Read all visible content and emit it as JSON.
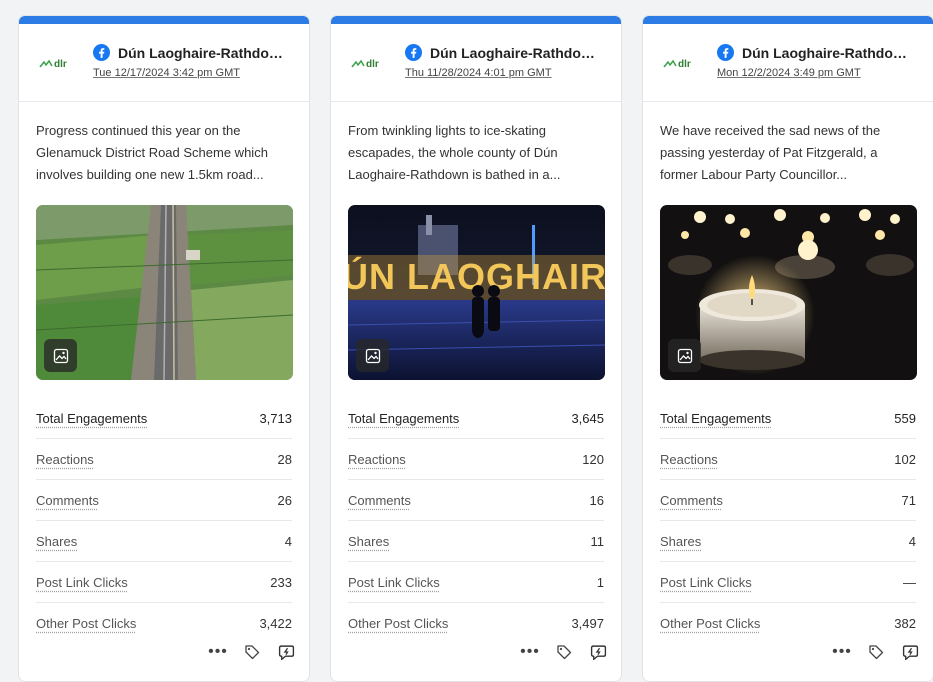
{
  "colors": {
    "accent": "#2d7be5",
    "facebook": "#1877f2",
    "dlr_green": "#3aa04a"
  },
  "icons": {
    "network": "facebook-icon",
    "media": "image-icon",
    "more": "more-icon",
    "tag": "tag-icon",
    "reply": "reply-icon"
  },
  "cards": [
    {
      "logo_text": "dlr",
      "account": "Dún Laoghaire-Rathdown ...",
      "date": "Tue 12/17/2024 3:42 pm GMT",
      "text": "Progress continued this year on the Glenamuck District Road Scheme which involves building one new 1.5km road...",
      "media": "aerial-road-photo",
      "metrics": [
        {
          "label": "Total Engagements",
          "value": "3,713"
        },
        {
          "label": "Reactions",
          "value": "28"
        },
        {
          "label": "Comments",
          "value": "26"
        },
        {
          "label": "Shares",
          "value": "4"
        },
        {
          "label": "Post Link Clicks",
          "value": "233"
        },
        {
          "label": "Other Post Clicks",
          "value": "3,422"
        }
      ]
    },
    {
      "logo_text": "dlr",
      "account": "Dún Laoghaire-Rathdown ...",
      "date": "Thu 11/28/2024 4:01 pm GMT",
      "text": "From twinkling lights to ice-skating escapades, the whole county of Dún Laoghaire-Rathdown is bathed in a...",
      "media": "night-lights-photo",
      "media_sign": "ÚN LAOGHAIR",
      "metrics": [
        {
          "label": "Total Engagements",
          "value": "3,645"
        },
        {
          "label": "Reactions",
          "value": "120"
        },
        {
          "label": "Comments",
          "value": "16"
        },
        {
          "label": "Shares",
          "value": "11"
        },
        {
          "label": "Post Link Clicks",
          "value": "1"
        },
        {
          "label": "Other Post Clicks",
          "value": "3,497"
        }
      ]
    },
    {
      "logo_text": "dlr",
      "account": "Dún Laoghaire-Rathdown ...",
      "date": "Mon 12/2/2024 3:49 pm GMT",
      "text": "We have received the sad news of the passing yesterday of Pat Fitzgerald, a former Labour Party Councillor...",
      "media": "candles-photo",
      "metrics": [
        {
          "label": "Total Engagements",
          "value": "559"
        },
        {
          "label": "Reactions",
          "value": "102"
        },
        {
          "label": "Comments",
          "value": "71"
        },
        {
          "label": "Shares",
          "value": "4"
        },
        {
          "label": "Post Link Clicks",
          "value": "—"
        },
        {
          "label": "Other Post Clicks",
          "value": "382"
        }
      ]
    }
  ]
}
